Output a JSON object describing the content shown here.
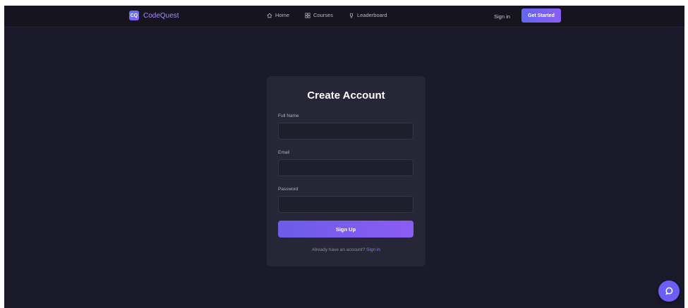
{
  "navbar": {
    "logo_text": "CodeQuest",
    "logo_icon_text": "CQ",
    "links": [
      {
        "label": "Home",
        "icon": "home-icon"
      },
      {
        "label": "Courses",
        "icon": "grid-icon"
      },
      {
        "label": "Leaderboard",
        "icon": "trophy-icon"
      }
    ],
    "signin_label": "Sign in",
    "cta_label": "Get Started"
  },
  "form": {
    "title": "Create Account",
    "fields": [
      {
        "label": "Full Name",
        "value": "",
        "placeholder": ""
      },
      {
        "label": "Email",
        "value": "",
        "placeholder": ""
      },
      {
        "label": "Password",
        "value": "",
        "placeholder": ""
      }
    ],
    "submit_label": "Sign Up",
    "footer_text": "Already have an account?",
    "footer_link": "Sign in"
  },
  "chat": {
    "icon": "chat-icon"
  },
  "colors": {
    "background": "#1b1a2b",
    "navbar": "#15141f",
    "card": "#272636",
    "accent": "#8b5cf6",
    "accent_blue": "#6366f1"
  }
}
